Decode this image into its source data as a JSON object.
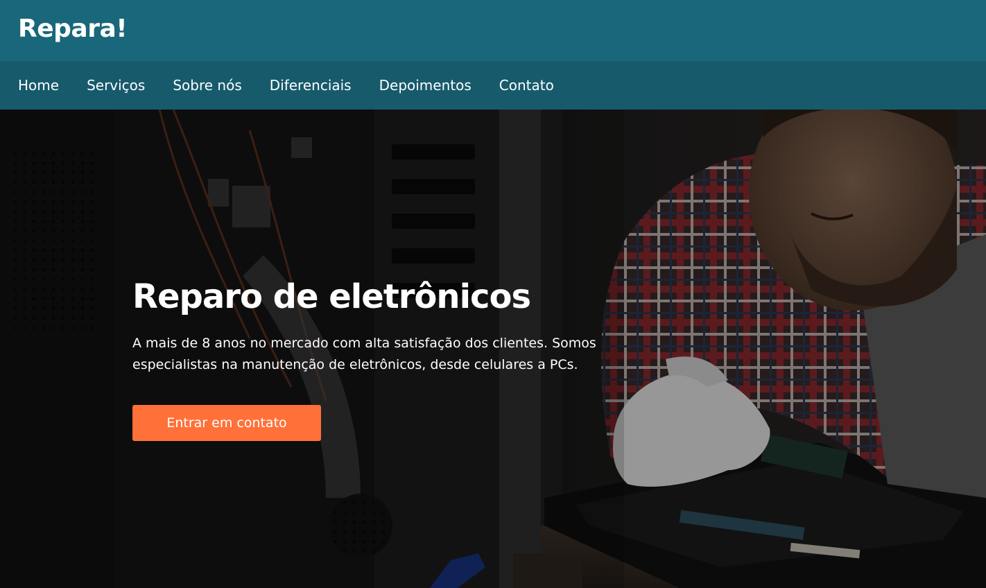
{
  "header": {
    "brand": "Repara!",
    "background_color": "#19677b"
  },
  "nav": {
    "background_color": "#175a6c",
    "items": [
      {
        "label": "Home"
      },
      {
        "label": "Serviços"
      },
      {
        "label": "Sobre nós"
      },
      {
        "label": "Diferenciais"
      },
      {
        "label": "Depoimentos"
      },
      {
        "label": "Contato"
      }
    ]
  },
  "hero": {
    "background_image": "technician-repairing-laptop-photo",
    "title": "Reparo de eletrônicos",
    "subtitle": "A mais de 8 anos no mercado com alta satisfação dos clientes. Somos especialistas na manutenção de eletrônicos, desde celulares a PCs.",
    "cta_label": "Entrar em contato",
    "cta_color": "#ff7139"
  }
}
